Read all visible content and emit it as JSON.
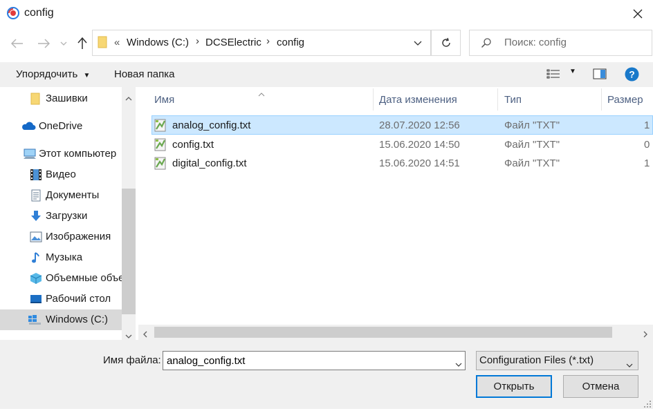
{
  "window": {
    "title": "config"
  },
  "address": {
    "overflow": "«",
    "crumbs": [
      "Windows (C:)",
      "DCSElectric",
      "config"
    ]
  },
  "search": {
    "placeholder": "Поиск: config"
  },
  "commands": {
    "organize": "Упорядочить",
    "new_folder": "Новая папка"
  },
  "nav": [
    {
      "label": "Зашивки",
      "icon": "folder-icon"
    },
    {
      "label": "OneDrive",
      "icon": "cloud-icon"
    },
    {
      "label": "Этот компьютер",
      "icon": "computer-icon"
    },
    {
      "label": "Видео",
      "icon": "video-icon"
    },
    {
      "label": "Документы",
      "icon": "documents-icon"
    },
    {
      "label": "Загрузки",
      "icon": "download-icon"
    },
    {
      "label": "Изображения",
      "icon": "pictures-icon"
    },
    {
      "label": "Музыка",
      "icon": "music-icon"
    },
    {
      "label": "Объемные объекты",
      "icon": "3d-objects-icon"
    },
    {
      "label": "Рабочий стол",
      "icon": "desktop-icon"
    },
    {
      "label": "Windows (C:)",
      "icon": "drive-icon"
    }
  ],
  "columns": {
    "name": "Имя",
    "date": "Дата изменения",
    "type": "Тип",
    "size": "Размер"
  },
  "files": [
    {
      "name": "analog_config.txt",
      "date": "28.07.2020 12:56",
      "type": "Файл \"TXT\"",
      "size": "1",
      "selected": true
    },
    {
      "name": "config.txt",
      "date": "15.06.2020 14:50",
      "type": "Файл \"TXT\"",
      "size": "0",
      "selected": false
    },
    {
      "name": "digital_config.txt",
      "date": "15.06.2020 14:51",
      "type": "Файл \"TXT\"",
      "size": "1",
      "selected": false
    }
  ],
  "footer": {
    "filename_label": "Имя файла:",
    "filename_value": "analog_config.txt",
    "filetype": "Configuration Files (*.txt)",
    "open": "Открыть",
    "cancel": "Отмена"
  },
  "colors": {
    "accent": "#0078d7",
    "selection": "#cce8ff"
  }
}
